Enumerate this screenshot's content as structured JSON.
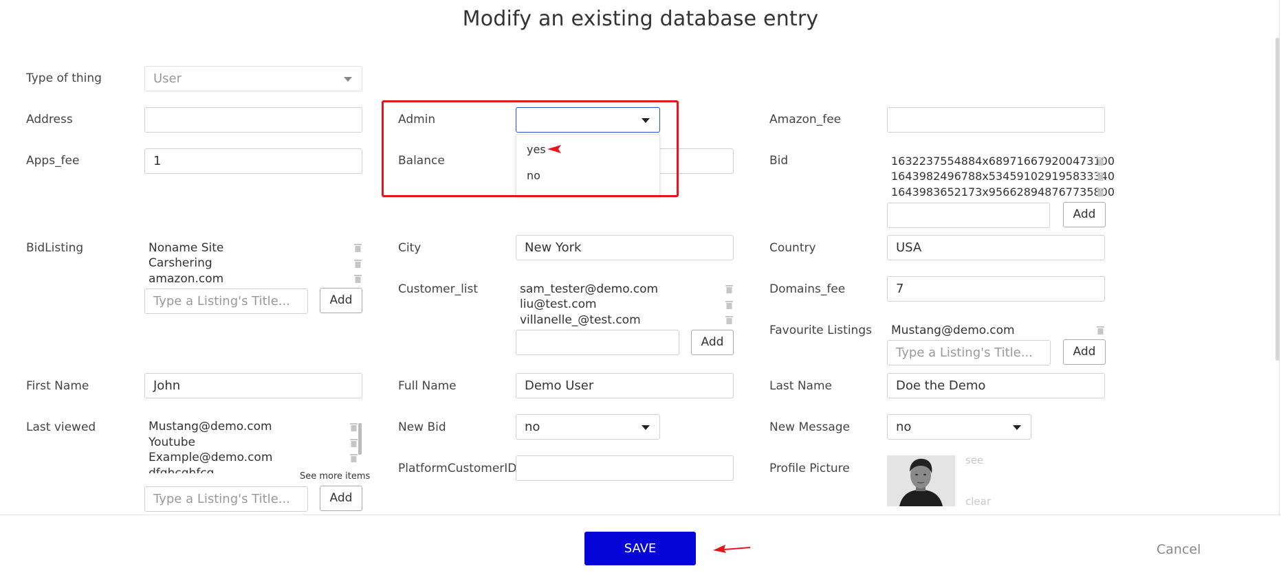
{
  "page": {
    "title": "Modify an existing database entry"
  },
  "fields": {
    "type_of_thing": {
      "label": "Type of thing",
      "value": "User"
    },
    "address": {
      "label": "Address",
      "value": ""
    },
    "admin": {
      "label": "Admin",
      "value": "",
      "options": [
        "yes",
        "no"
      ]
    },
    "amazon_fee": {
      "label": "Amazon_fee",
      "value": ""
    },
    "apps_fee": {
      "label": "Apps_fee",
      "value": "1"
    },
    "balance": {
      "label": "Balance",
      "value": ""
    },
    "bid": {
      "label": "Bid",
      "items": [
        "1632237554884x689716679200473100",
        "1643982496788x534591029195833340",
        "1643983652173x956628948767735800"
      ],
      "add_label": "Add"
    },
    "bid_listing": {
      "label": "BidListing",
      "items": [
        "Noname Site",
        "Carshering",
        "amazon.com"
      ],
      "placeholder": "Type a Listing's Title...",
      "add_label": "Add"
    },
    "city": {
      "label": "City",
      "value": "New York"
    },
    "country": {
      "label": "Country",
      "value": "USA"
    },
    "customer_list": {
      "label": "Customer_list",
      "items": [
        "sam_tester@demo.com",
        "liu@test.com",
        "villanelle_@test.com"
      ],
      "add_label": "Add"
    },
    "domains_fee": {
      "label": "Domains_fee",
      "value": "7"
    },
    "favourite_listings": {
      "label": "Favourite Listings",
      "items": [
        "Mustang@demo.com"
      ],
      "placeholder": "Type a Listing's Title...",
      "add_label": "Add"
    },
    "first_name": {
      "label": "First Name",
      "value": "John"
    },
    "full_name": {
      "label": "Full Name",
      "value": "Demo User"
    },
    "last_name": {
      "label": "Last Name",
      "value": "Doe the Demo"
    },
    "last_viewed": {
      "label": "Last viewed",
      "items": [
        "Mustang@demo.com",
        "Youtube",
        "Example@demo.com",
        "dfghcghfcg"
      ],
      "see_more": "See more items",
      "placeholder": "Type a Listing's Title...",
      "add_label": "Add"
    },
    "new_bid": {
      "label": "New Bid",
      "value": "no"
    },
    "new_message": {
      "label": "New Message",
      "value": "no"
    },
    "platform_customer_id": {
      "label": "PlatformCustomerID",
      "value": ""
    },
    "profile_picture": {
      "label": "Profile Picture",
      "see_label": "see",
      "clear_label": "clear"
    }
  },
  "footer": {
    "save_label": "SAVE",
    "cancel_label": "Cancel"
  },
  "colors": {
    "save_button": "#0505d8",
    "highlight_box": "#e8141c",
    "annotation_arrow": "#e8141c"
  }
}
